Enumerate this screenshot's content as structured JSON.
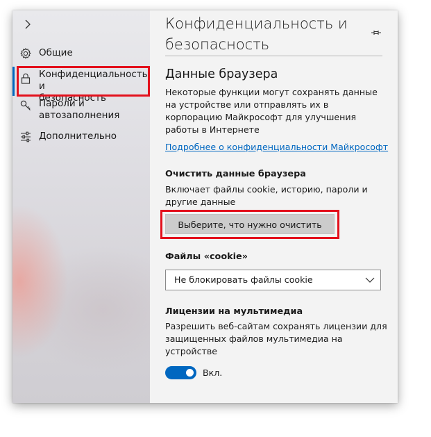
{
  "sidebar": {
    "items": [
      {
        "label": "Общие",
        "icon": "gear-icon"
      },
      {
        "label": "Конфиденциальность и\nбезопасность",
        "icon": "lock-icon"
      },
      {
        "label": "Пароли и\nавтозаполнения",
        "icon": "key-icon"
      },
      {
        "label": "Дополнительно",
        "icon": "sliders-icon"
      }
    ],
    "collapse_icon": "chevron-right-icon",
    "active_color": "#0067c0"
  },
  "main": {
    "title": "Конфиденциальность и безопасность",
    "pin_icon": "pin-icon",
    "browser_data": {
      "heading": "Данные браузера",
      "description": "Некоторые функции могут сохранять данные на устройстве или отправлять их в корпорацию Майкрософт для улучшения работы в Интернете",
      "link": "Подробнее о конфиденциальности Майкрософт"
    },
    "clear_data": {
      "heading": "Очистить данные браузера",
      "description": "Включает файлы cookie, историю, пароли и другие данные",
      "button_label": "Выберите, что нужно очистить"
    },
    "cookies": {
      "heading": "Файлы «cookie»",
      "selected": "Не блокировать файлы cookie"
    },
    "media_licenses": {
      "heading": "Лицензии на мультимедиа",
      "description": "Разрешить веб-сайтам сохранять лицензии для защищенных файлов мультимедиа на устройстве",
      "toggle_label": "Вкл.",
      "toggle_on": true
    }
  },
  "highlight_color": "#e3101c",
  "link_color": "#0067c0"
}
